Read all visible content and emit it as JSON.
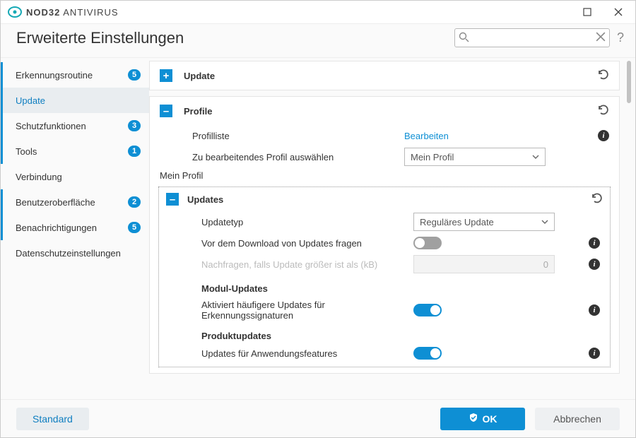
{
  "app": {
    "name_bold": "NOD32",
    "name_rest": " ANTIVIRUS"
  },
  "header": {
    "title": "Erweiterte Einstellungen",
    "search_placeholder": ""
  },
  "sidebar": {
    "items": [
      {
        "label": "Erkennungsroutine",
        "badge": "5"
      },
      {
        "label": "Update"
      },
      {
        "label": "Schutzfunktionen",
        "badge": "3"
      },
      {
        "label": "Tools",
        "badge": "1"
      },
      {
        "label": "Verbindung"
      },
      {
        "label": "Benutzeroberfläche",
        "badge": "2"
      },
      {
        "label": "Benachrichtigungen",
        "badge": "5"
      },
      {
        "label": "Datenschutzeinstellungen"
      }
    ]
  },
  "panels": {
    "update": {
      "title": "Update"
    },
    "profile": {
      "title": "Profile",
      "profile_list_label": "Profilliste",
      "profile_list_action": "Bearbeiten",
      "select_profile_label": "Zu bearbeitendes Profil auswählen",
      "selected_profile": "Mein Profil"
    }
  },
  "section_name": "Mein Profil",
  "updates": {
    "title": "Updates",
    "type_label": "Updatetyp",
    "type_value": "Reguläres Update",
    "ask_before_label": "Vor dem Download von Updates fragen",
    "ask_before_on": false,
    "ask_size_label": "Nachfragen, falls Update größer ist als (kB)",
    "ask_size_value": "0",
    "module_heading": "Modul-Updates",
    "module_freq_label": "Aktiviert häufigere Updates für Erkennungssignaturen",
    "module_freq_on": true,
    "product_heading": "Produktupdates",
    "product_feat_label": "Updates für Anwendungsfeatures",
    "product_feat_on": true
  },
  "footer": {
    "default": "Standard",
    "ok": "OK",
    "cancel": "Abbrechen"
  }
}
